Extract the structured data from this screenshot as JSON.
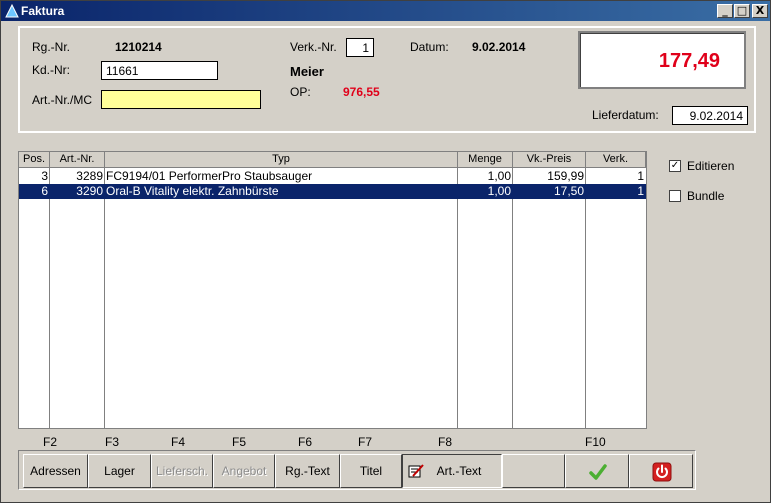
{
  "window": {
    "title": "Faktura",
    "min": "_",
    "max": "□",
    "close": "X"
  },
  "header": {
    "rg_label": "Rg.-Nr.",
    "rg_value": "1210214",
    "kd_label": "Kd.-Nr:",
    "kd_value": "11661",
    "art_label": "Art.-Nr./MC",
    "art_value": "",
    "verk_label": "Verk.-Nr.",
    "verk_value": "1",
    "customer_name": "Meier",
    "op_label": "OP:",
    "op_value": "976,55",
    "datum_label": "Datum:",
    "datum_value": "9.02.2014",
    "total": "177,49",
    "liefer_label": "Lieferdatum:",
    "liefer_value": "9.02.2014",
    "total_color": "#e0001a",
    "art_field_color": "#ffff99"
  },
  "grid": {
    "columns": [
      "Pos.",
      "Art.-Nr.",
      "Typ",
      "Menge",
      "Vk.-Preis",
      "Verk."
    ],
    "rows": [
      {
        "pos": "3",
        "art": "3289",
        "typ": "FC9194/01 PerformerPro Staubsauger",
        "menge": "1,00",
        "preis": "159,99",
        "verk": "1",
        "selected": false
      },
      {
        "pos": "6",
        "art": "3290",
        "typ": "Oral-B Vitality elektr. Zahnbürste",
        "menge": "1,00",
        "preis": "17,50",
        "verk": "1",
        "selected": true
      }
    ],
    "selection_color": "#0a246a"
  },
  "options": {
    "editieren_label": "Editieren",
    "editieren_checked": true,
    "bundle_label": "Bundle",
    "bundle_checked": false
  },
  "fkeys": {
    "f2": "F2",
    "f3": "F3",
    "f4": "F4",
    "f5": "F5",
    "f6": "F6",
    "f7": "F7",
    "f8": "F8",
    "f10": "F10"
  },
  "toolbar": {
    "adressen": "Adressen",
    "lager": "Lager",
    "liefersch": "Liefersch.",
    "angebot": "Angebot",
    "rgtext": "Rg.-Text",
    "titel": "Titel",
    "arttext": "Art.-Text",
    "ok_icon": "checkmark-icon",
    "power_icon": "power-icon"
  }
}
